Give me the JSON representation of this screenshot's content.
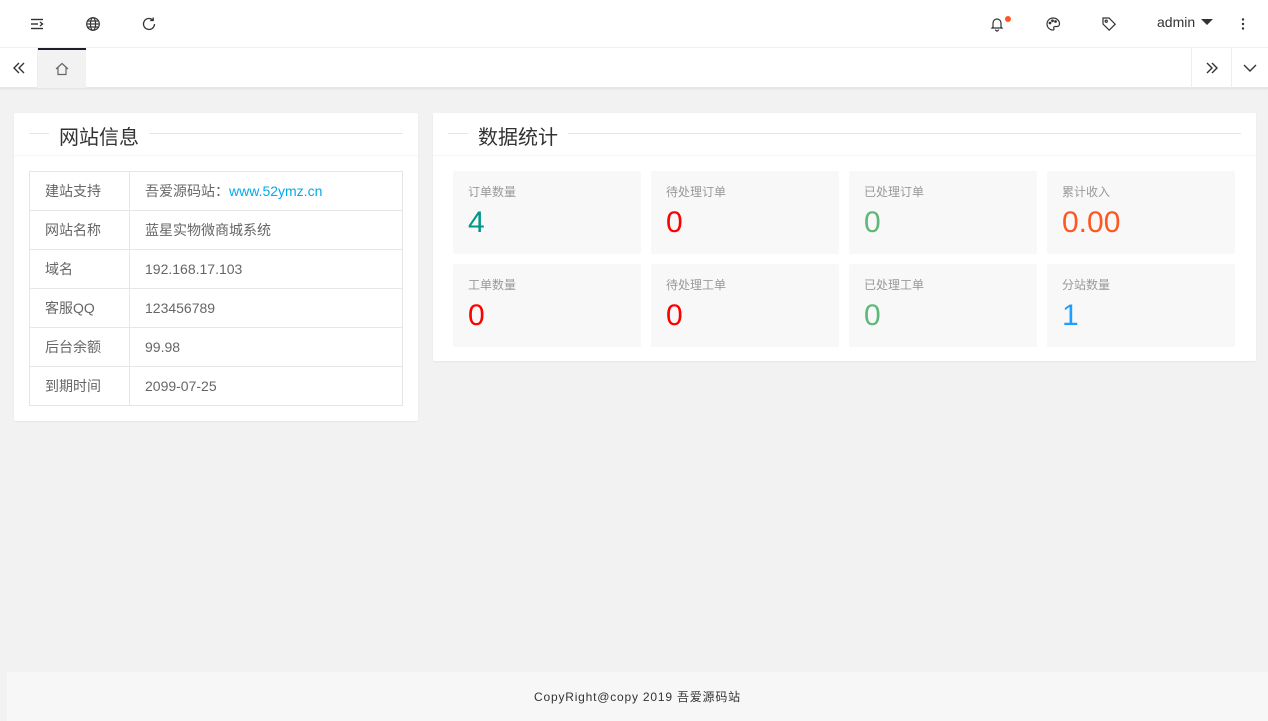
{
  "header": {
    "user_name": "admin"
  },
  "site_info": {
    "title": "网站信息",
    "rows": [
      {
        "label": "建站支持",
        "prefix": "吾爱源码站：",
        "link": "www.52ymz.cn"
      },
      {
        "label": "网站名称",
        "value": "蓝星实物微商城系统"
      },
      {
        "label": "域名",
        "value": "192.168.17.103"
      },
      {
        "label": "客服QQ",
        "value": "123456789"
      },
      {
        "label": "后台余额",
        "value": "99.98"
      },
      {
        "label": "到期时间",
        "value": "2099-07-25"
      }
    ]
  },
  "stats": {
    "title": "数据统计",
    "items": [
      {
        "label": "订单数量",
        "value": "4",
        "color": "#009688"
      },
      {
        "label": "待处理订单",
        "value": "0",
        "color": "#ff0000"
      },
      {
        "label": "已处理订单",
        "value": "0",
        "color": "#5FB878"
      },
      {
        "label": "累计收入",
        "value": "0.00",
        "color": "#FF5722"
      },
      {
        "label": "工单数量",
        "value": "0",
        "color": "#ff0000"
      },
      {
        "label": "待处理工单",
        "value": "0",
        "color": "#ff0000"
      },
      {
        "label": "已处理工单",
        "value": "0",
        "color": "#5FB878"
      },
      {
        "label": "分站数量",
        "value": "1",
        "color": "#1E9FFF"
      }
    ]
  },
  "footer": {
    "text": "CopyRight@copy 2019 吾爱源码站"
  }
}
